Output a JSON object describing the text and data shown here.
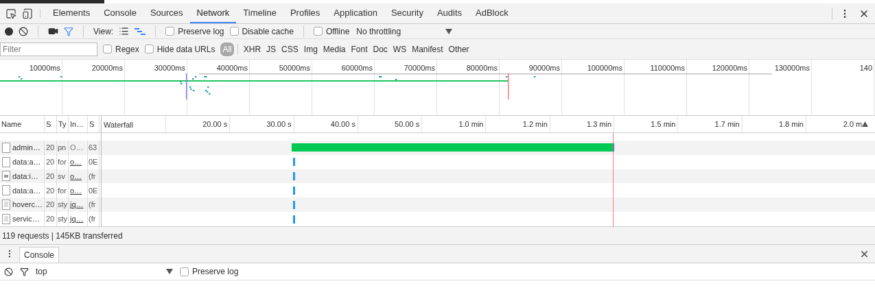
{
  "panel_tabs": [
    {
      "label": "Elements",
      "selected": false
    },
    {
      "label": "Console",
      "selected": false
    },
    {
      "label": "Sources",
      "selected": false
    },
    {
      "label": "Network",
      "selected": true
    },
    {
      "label": "Timeline",
      "selected": false
    },
    {
      "label": "Profiles",
      "selected": false
    },
    {
      "label": "Application",
      "selected": false
    },
    {
      "label": "Security",
      "selected": false
    },
    {
      "label": "Audits",
      "selected": false
    },
    {
      "label": "AdBlock",
      "selected": false
    }
  ],
  "toolbar": {
    "filter_active": true,
    "view_label": "View:",
    "views": [
      {
        "kind": "list",
        "selected": false
      },
      {
        "kind": "waterfall",
        "selected": true
      }
    ],
    "checkboxes": [
      {
        "label": "Preserve log",
        "checked": false
      },
      {
        "label": "Disable cache",
        "checked": false
      }
    ],
    "offline": {
      "label": "Offline",
      "checked": false
    },
    "throttling": "No throttling"
  },
  "filter_bar": {
    "placeholder": "Filter",
    "checkboxes": [
      {
        "label": "Regex",
        "checked": false
      },
      {
        "label": "Hide data URLs",
        "checked": false
      }
    ],
    "types": [
      {
        "label": "All",
        "selected": true
      },
      {
        "label": "XHR",
        "selected": false
      },
      {
        "label": "JS",
        "selected": false
      },
      {
        "label": "CSS",
        "selected": false
      },
      {
        "label": "Img",
        "selected": false
      },
      {
        "label": "Media",
        "selected": false
      },
      {
        "label": "Font",
        "selected": false
      },
      {
        "label": "Doc",
        "selected": false
      },
      {
        "label": "WS",
        "selected": false
      },
      {
        "label": "Manifest",
        "selected": false
      },
      {
        "label": "Other",
        "selected": false
      }
    ]
  },
  "overview": {
    "ticks": [
      "10000ms",
      "20000ms",
      "30000ms",
      "40000ms",
      "50000ms",
      "60000ms",
      "70000ms",
      "80000ms",
      "90000ms",
      "100000ms",
      "110000ms",
      "120000ms",
      "130000ms",
      "140"
    ]
  },
  "table": {
    "columns": [
      "Name",
      "S",
      "Ty",
      "In…",
      "S",
      "Waterfall"
    ],
    "waterfall_ticks": [
      "20.00 s",
      "30.00 s",
      "40.00 s",
      "50.00 s",
      "1.0 min",
      "1.2 min",
      "1.3 min",
      "1.5 min",
      "1.7 min",
      "1.8 min",
      "2.0 m"
    ],
    "rows": [
      {
        "kind": "blank",
        "name": "admin…",
        "status": "20",
        "type": "pn",
        "initiator": "O…",
        "initiator_link": false,
        "size": "63",
        "timing": {
          "kind": "long"
        }
      },
      {
        "kind": "blank",
        "name": "data:a…",
        "status": "20",
        "type": "for",
        "initiator": "o…",
        "initiator_link": true,
        "size": "0E",
        "timing": {
          "kind": "tick"
        }
      },
      {
        "kind": "image",
        "name": "data:i…",
        "status": "20",
        "type": "sv",
        "initiator": "o…",
        "initiator_link": true,
        "size": "(fr",
        "timing": {
          "kind": "tick"
        }
      },
      {
        "kind": "blank",
        "name": "data:a…",
        "status": "20",
        "type": "for",
        "initiator": "o…",
        "initiator_link": true,
        "size": "0E",
        "timing": {
          "kind": "tick"
        }
      },
      {
        "kind": "doc",
        "name": "hoverc…",
        "status": "20",
        "type": "sty",
        "initiator": "jq…",
        "initiator_link": true,
        "size": "(fr",
        "timing": {
          "kind": "tick"
        }
      },
      {
        "kind": "doc",
        "name": "servic…",
        "status": "20",
        "type": "sty",
        "initiator": "jq…",
        "initiator_link": true,
        "size": "(fr",
        "timing": {
          "kind": "tick"
        }
      }
    ]
  },
  "status_bar": "119 requests | 145KB transferred",
  "drawer": {
    "tabs": [
      {
        "label": "Console",
        "selected": true
      }
    ],
    "context": "top",
    "preserve_log": {
      "label": "Preserve log",
      "checked": false
    }
  }
}
